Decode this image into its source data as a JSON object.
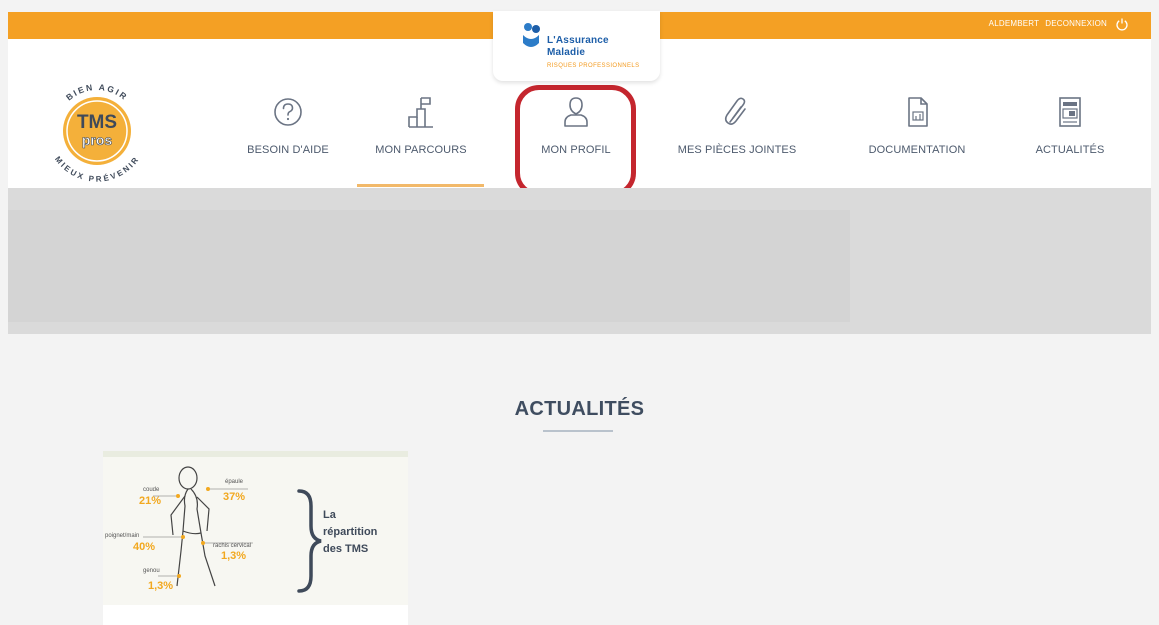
{
  "topbar": {
    "user_name": "ALDEMBERT",
    "logout_label": "DECONNEXION",
    "power_icon": "power-icon"
  },
  "brand": {
    "line1": "L'Assurance",
    "line2": "Maladie",
    "tagline": "RISQUES PROFESSIONNELS"
  },
  "logo": {
    "main": "TMS",
    "sub": "pros",
    "ring_top": "BIEN AGIR",
    "ring_bottom": "MIEUX PRÉVENIR"
  },
  "nav": {
    "items": [
      {
        "label": "BESOIN D'AIDE",
        "icon": "question-circle-icon"
      },
      {
        "label": "MON PARCOURS",
        "icon": "stairs-flag-icon",
        "active": true
      },
      {
        "label": "MON PROFIL",
        "icon": "user-icon",
        "highlighted": true
      },
      {
        "label": "MES PIÈCES JOINTES",
        "icon": "paperclip-icon"
      },
      {
        "label": "DOCUMENTATION",
        "icon": "document-icon"
      },
      {
        "label": "ACTUALITÉS",
        "icon": "news-icon"
      }
    ]
  },
  "news": {
    "title": "ACTUALITÉS",
    "card": {
      "heading_line1": "La",
      "heading_line2": "répartition",
      "heading_line3": "des TMS",
      "stats": [
        {
          "label": "coude",
          "value": "21%"
        },
        {
          "label": "épaule",
          "value": "37%"
        },
        {
          "label": "poignet/main",
          "value": "40%"
        },
        {
          "label": "rachis cervical",
          "value": "1,3%"
        },
        {
          "label": "genou",
          "value": "1,3%"
        }
      ]
    }
  },
  "colors": {
    "accent_orange": "#f4a024",
    "text_dark": "#4d5a6d",
    "highlight_red": "#c4262e",
    "brand_blue": "#1d5ea8"
  }
}
